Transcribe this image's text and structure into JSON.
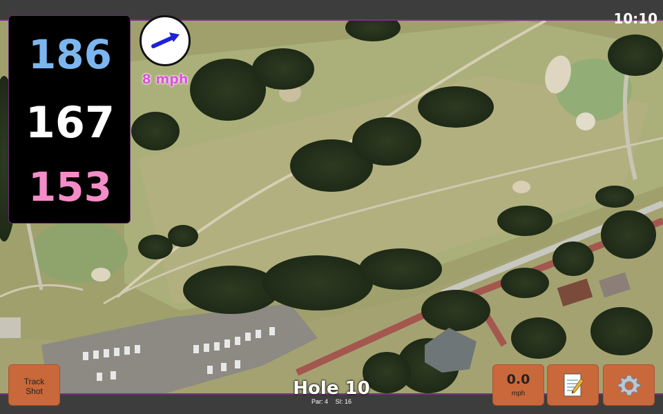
{
  "status": {
    "time": "10:10"
  },
  "distances": {
    "back": "186",
    "middle": "167",
    "front": "153"
  },
  "wind": {
    "speed": "8 mph",
    "icon": "wind-direction-arrow-icon"
  },
  "hole": {
    "title": "Hole 10",
    "par": "Par: 4",
    "stroke_index": "SI: 16"
  },
  "buttons": {
    "track_line1": "Track",
    "track_line2": "Shot",
    "speed_value": "0.0",
    "speed_unit": "mph",
    "notes_icon": "notepad-icon",
    "settings_icon": "gear-icon"
  },
  "colors": {
    "back_distance": "#7cb6ef",
    "middle_distance": "#ffffff",
    "front_distance": "#f48cc8",
    "wind_text": "#e04fe0",
    "button": "#c9683a",
    "accent_border": "#7a2f8a"
  }
}
